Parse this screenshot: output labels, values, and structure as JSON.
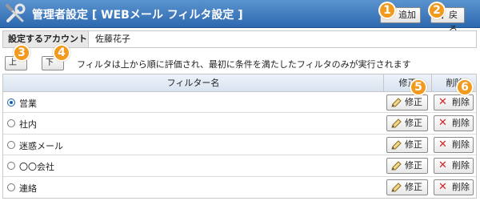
{
  "header": {
    "title": "管理者設定 [ WEBメール フィルタ設定 ]",
    "add_label": "追加",
    "back_label": "戻る"
  },
  "account": {
    "label": "設定するアカウント",
    "value": "佐藤花子"
  },
  "move": {
    "up_label": "上",
    "down_label": "下"
  },
  "notice": "フィルタは上から順に評価され、最初に条件を満たしたフィルタのみが実行されます",
  "table": {
    "columns": [
      "フィルター名",
      "修正",
      "削除"
    ],
    "rows": [
      {
        "name": "営業",
        "selected": true,
        "edit_label": "修正",
        "delete_label": "削除"
      },
      {
        "name": "社内",
        "selected": false,
        "edit_label": "修正",
        "delete_label": "削除"
      },
      {
        "name": "迷惑メール",
        "selected": false,
        "edit_label": "修正",
        "delete_label": "削除"
      },
      {
        "name": "〇〇会社",
        "selected": false,
        "edit_label": "修正",
        "delete_label": "削除"
      },
      {
        "name": "連絡",
        "selected": false,
        "edit_label": "修正",
        "delete_label": "削除"
      }
    ]
  },
  "callouts": [
    "1",
    "2",
    "3",
    "4",
    "5",
    "6"
  ],
  "colors": {
    "header": "#2d69b0",
    "callout": "#f19a1e",
    "delete_icon": "#d42424",
    "add_icon": "#2a9a2a"
  },
  "icons": {
    "header": "tools-icon",
    "add": "plus-icon",
    "back": "back-arrow-icon",
    "edit": "pencil-icon",
    "delete": "x-icon"
  }
}
